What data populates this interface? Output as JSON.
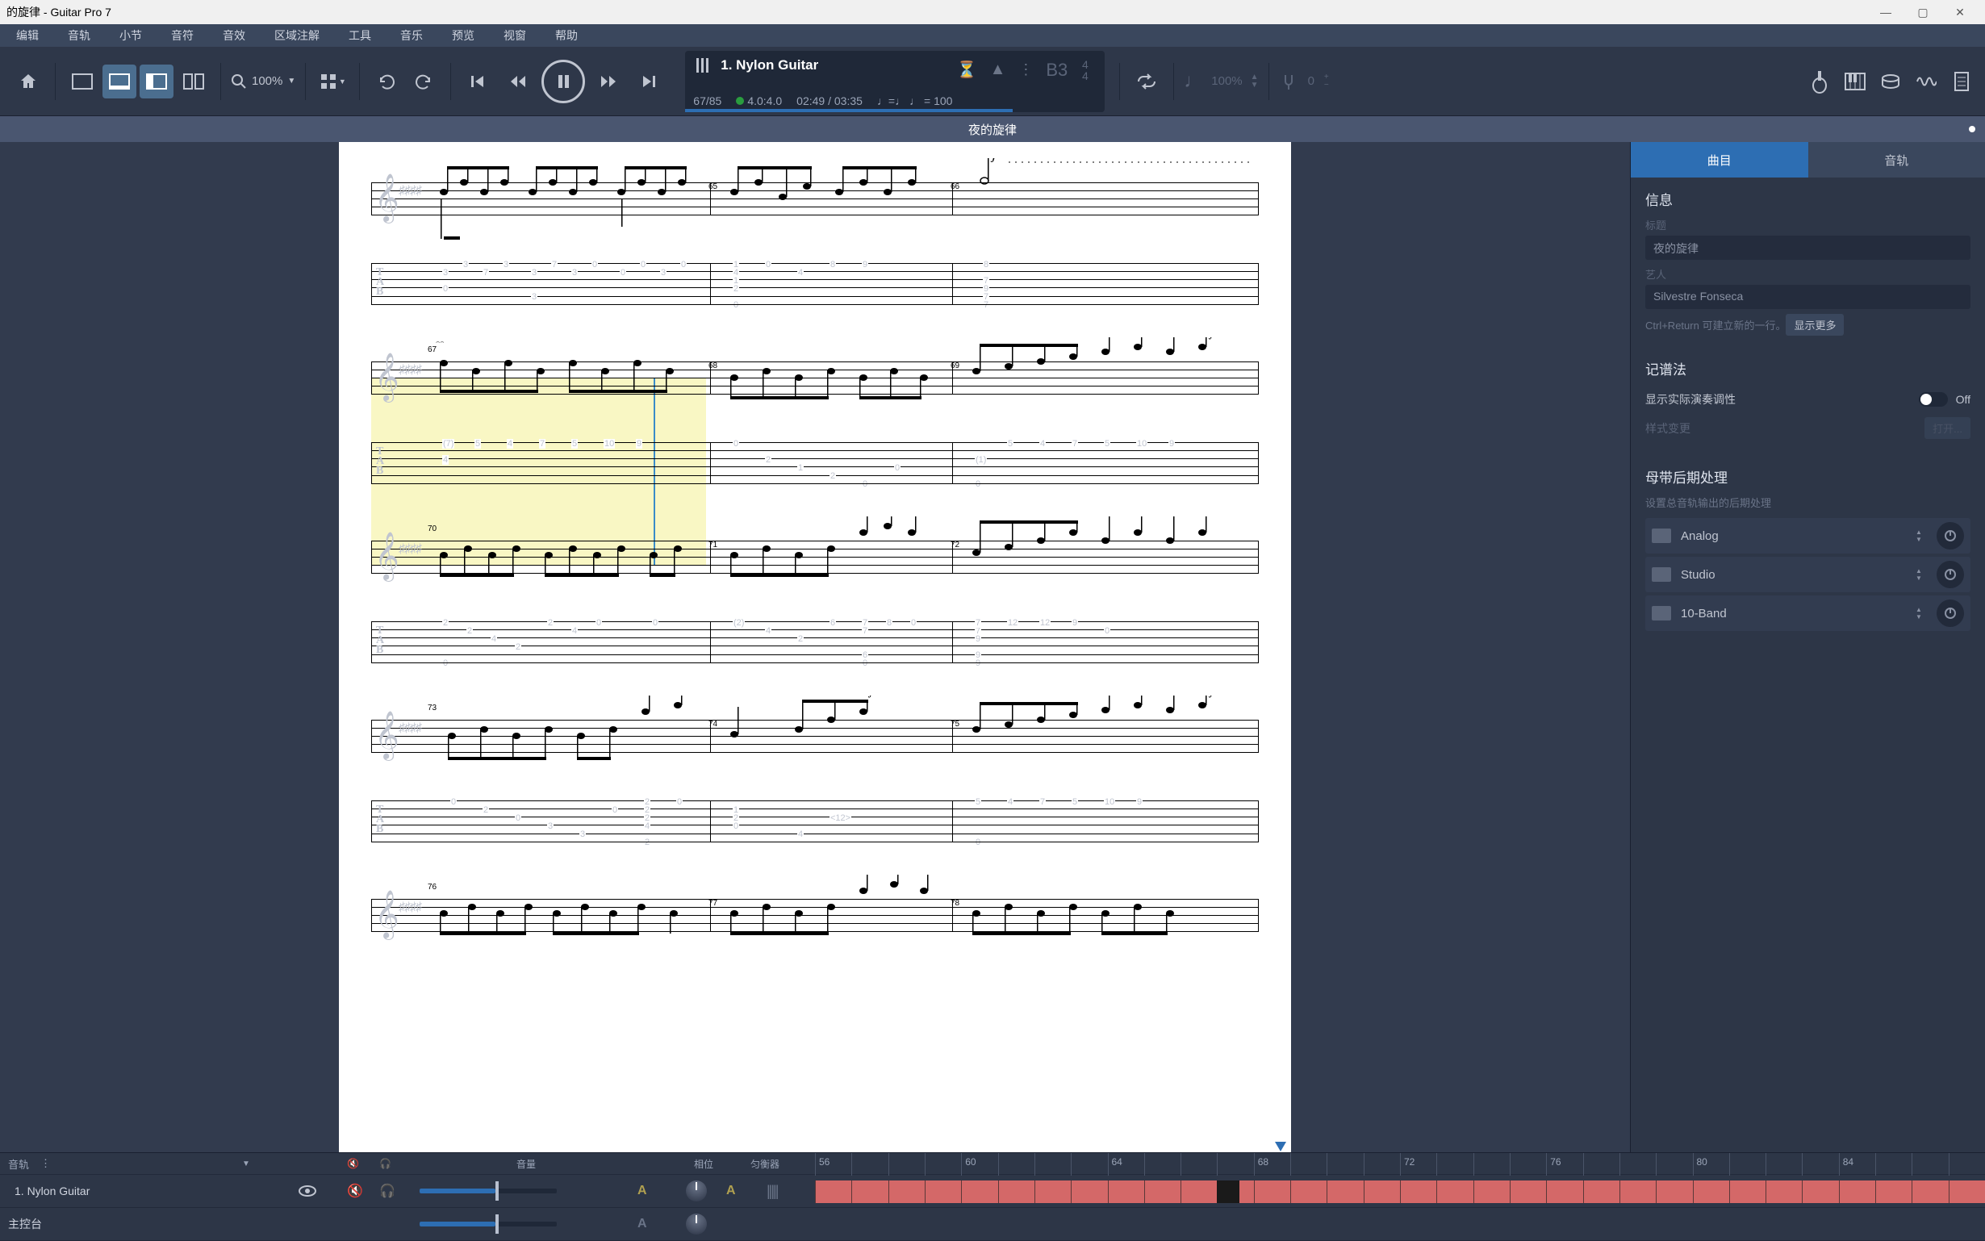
{
  "window": {
    "title": "的旋律 - Guitar Pro 7"
  },
  "menu": {
    "items": [
      "编辑",
      "音轨",
      "小节",
      "音符",
      "音效",
      "区域注解",
      "工具",
      "音乐",
      "预览",
      "视窗",
      "帮助"
    ]
  },
  "toolbar": {
    "zoom_pct": "100%"
  },
  "transport": {
    "track_title": "1. Nylon Guitar",
    "bars": "67/85",
    "signature": "4.0:4.0",
    "time_current": "02:49",
    "time_total": "03:35",
    "tempo": "= 100",
    "capo": "B3"
  },
  "tempo_right": {
    "pct": "100%",
    "pitch": "0"
  },
  "song_title": "夜的旋律",
  "side": {
    "tabs": {
      "song": "曲目",
      "tracks": "音轨"
    },
    "info_h": "信息",
    "label_title": "标题",
    "field_title": "夜的旋律",
    "label_artist": "艺人",
    "field_artist": "Silvestre Fonseca",
    "hint": "Ctrl+Return 可建立新的一行。",
    "show_more": "显示更多",
    "notation_h": "记谱法",
    "notation_toggle_label": "显示实际演奏调性",
    "notation_toggle_val": "Off",
    "style_label": "样式变更",
    "style_btn": "打开...",
    "mastering_h": "母带后期处理",
    "mastering_desc": "设置总音轨输出的后期处理",
    "fx": [
      {
        "name": "Analog"
      },
      {
        "name": "Studio"
      },
      {
        "name": "10-Band"
      }
    ]
  },
  "mixer": {
    "track_label": "音轨",
    "volume_label": "音量",
    "pan_label": "相位",
    "eq_label": "匀衡器",
    "nylon": "1. Nylon Guitar",
    "master": "主控台",
    "beat_labels": [
      "56",
      "60",
      "64",
      "68",
      "72",
      "76",
      "80",
      "84"
    ]
  }
}
